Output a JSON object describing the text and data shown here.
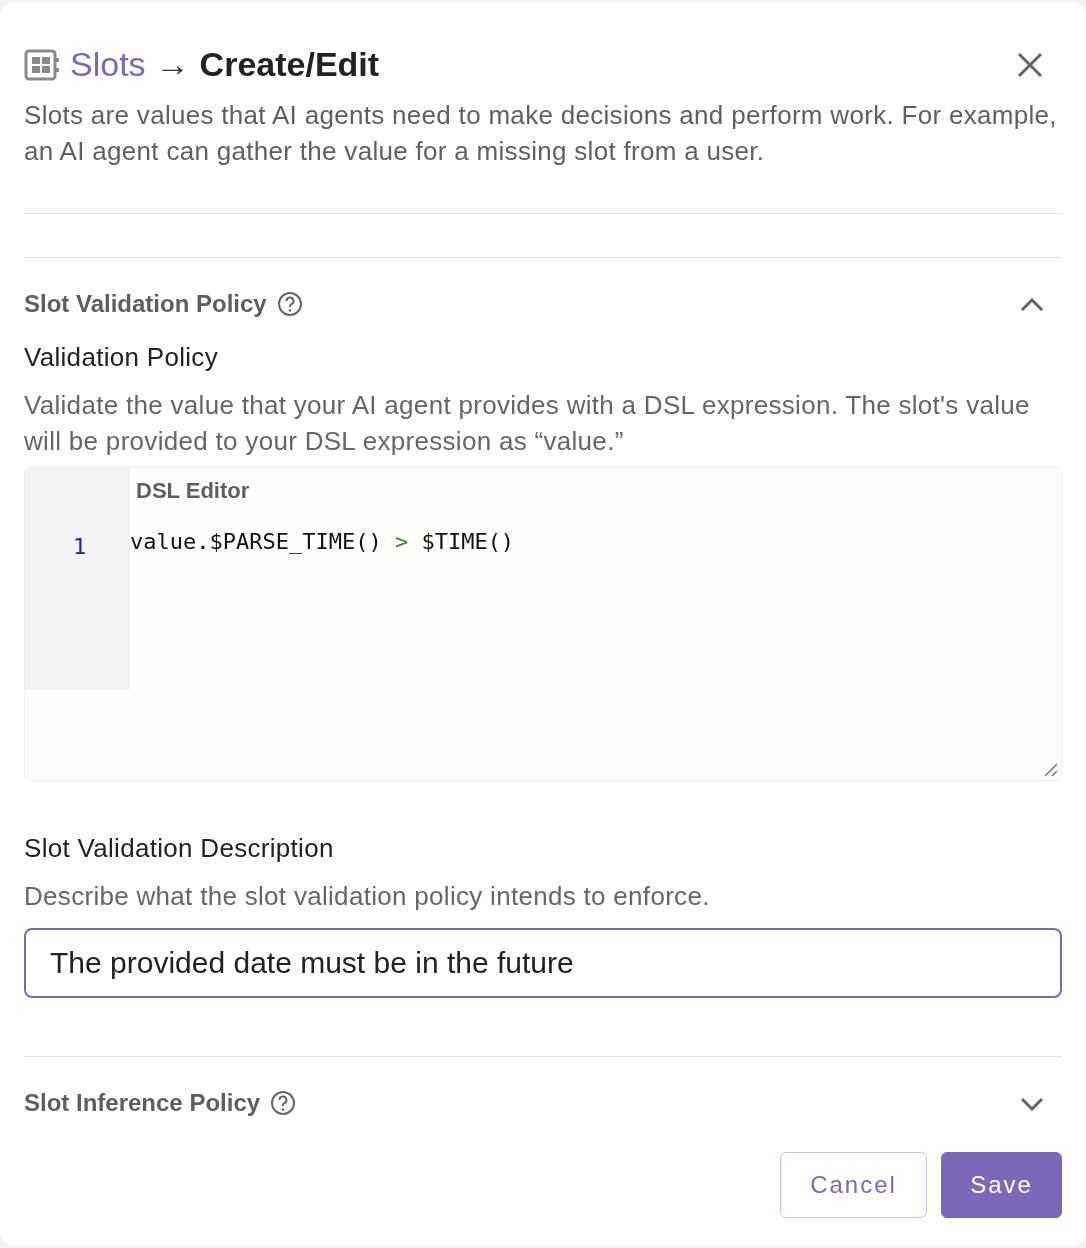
{
  "dialog": {
    "title_link": "Slots",
    "arrow": "→",
    "title": "Create/Edit",
    "description": "Slots are values that AI agents need to make decisions and perform work. For example, an AI agent can gather the value for a missing slot from a user."
  },
  "sections": [
    {
      "title": "Slot Validation Policy",
      "expanded": true,
      "fields": [
        {
          "kind": "code",
          "label": "Validation Policy",
          "help": "Validate the value that your AI agent provides with a DSL expression. The slot's value will be provided to your DSL expression as “value.”",
          "editor_label": "DSL Editor",
          "lines": [
            {
              "number": "1",
              "tokens": [
                {
                  "kind": "plain",
                  "text": "value.$PARSE_TIME() "
                },
                {
                  "kind": "operator",
                  "text": ">"
                },
                {
                  "kind": "plain",
                  "text": " $TIME()"
                }
              ]
            }
          ]
        },
        {
          "kind": "text",
          "label": "Slot Validation Description",
          "help": "Describe what the slot validation policy intends to enforce.",
          "value": "The provided date must be in the future",
          "focused": true
        }
      ]
    },
    {
      "title": "Slot Inference Policy",
      "expanded": false
    }
  ],
  "buttons": [
    {
      "label": "Cancel",
      "kind": "secondary"
    },
    {
      "label": "Save",
      "kind": "primary"
    }
  ]
}
